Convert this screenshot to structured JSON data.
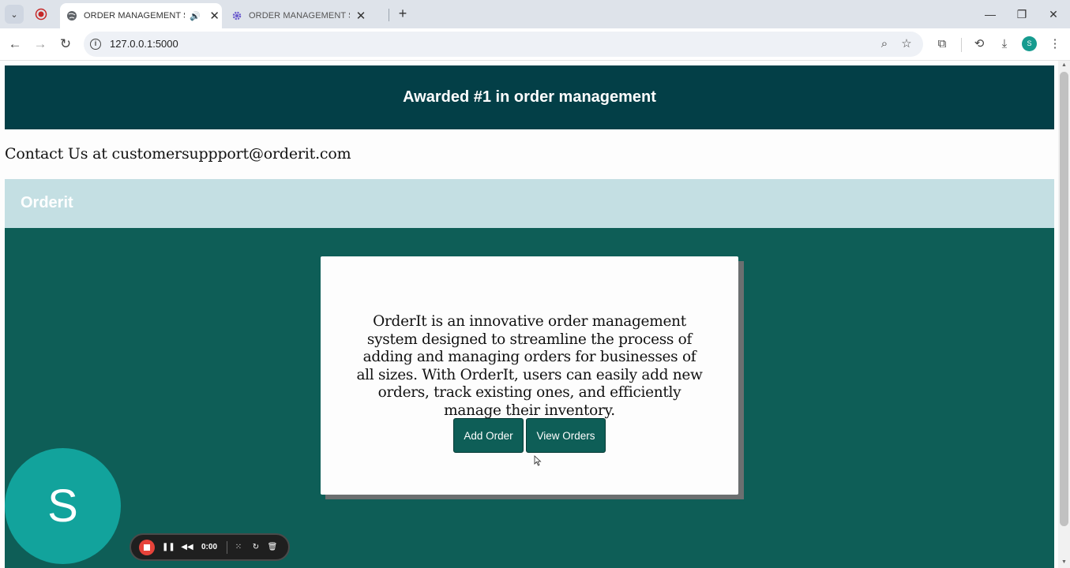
{
  "browser": {
    "tabs": [
      {
        "title": "ORDER MANAGEMENT SYS",
        "active": true
      },
      {
        "title": "ORDER MANAGEMENT SYSTEM",
        "active": false
      }
    ],
    "new_tab": "+",
    "address": "127.0.0.1:5000",
    "profile_initial": "S",
    "window": {
      "minimize": "—",
      "restore": "❐",
      "close": "✕"
    }
  },
  "page": {
    "banner_text": "Awarded #1 in order management",
    "contact_text": "Contact Us at customersuppport@orderit.com",
    "brand": "Orderit",
    "description": "OrderIt is an innovative order management system designed to streamline the process of adding and managing orders for businesses of all sizes. With OrderIt, users can easily add new orders, track existing ones, and efficiently manage their inventory.",
    "buttons": {
      "add_order": "Add Order",
      "view_orders": "View Orders"
    }
  },
  "overlay": {
    "avatar_initial": "S",
    "recorder_time": "0:00"
  },
  "colors": {
    "banner": "#033f47",
    "brand_bar": "#c4dfe3",
    "hero": "#0e5e57",
    "button": "#0e5e57",
    "avatar": "#12a39c",
    "record": "#e6433a"
  }
}
